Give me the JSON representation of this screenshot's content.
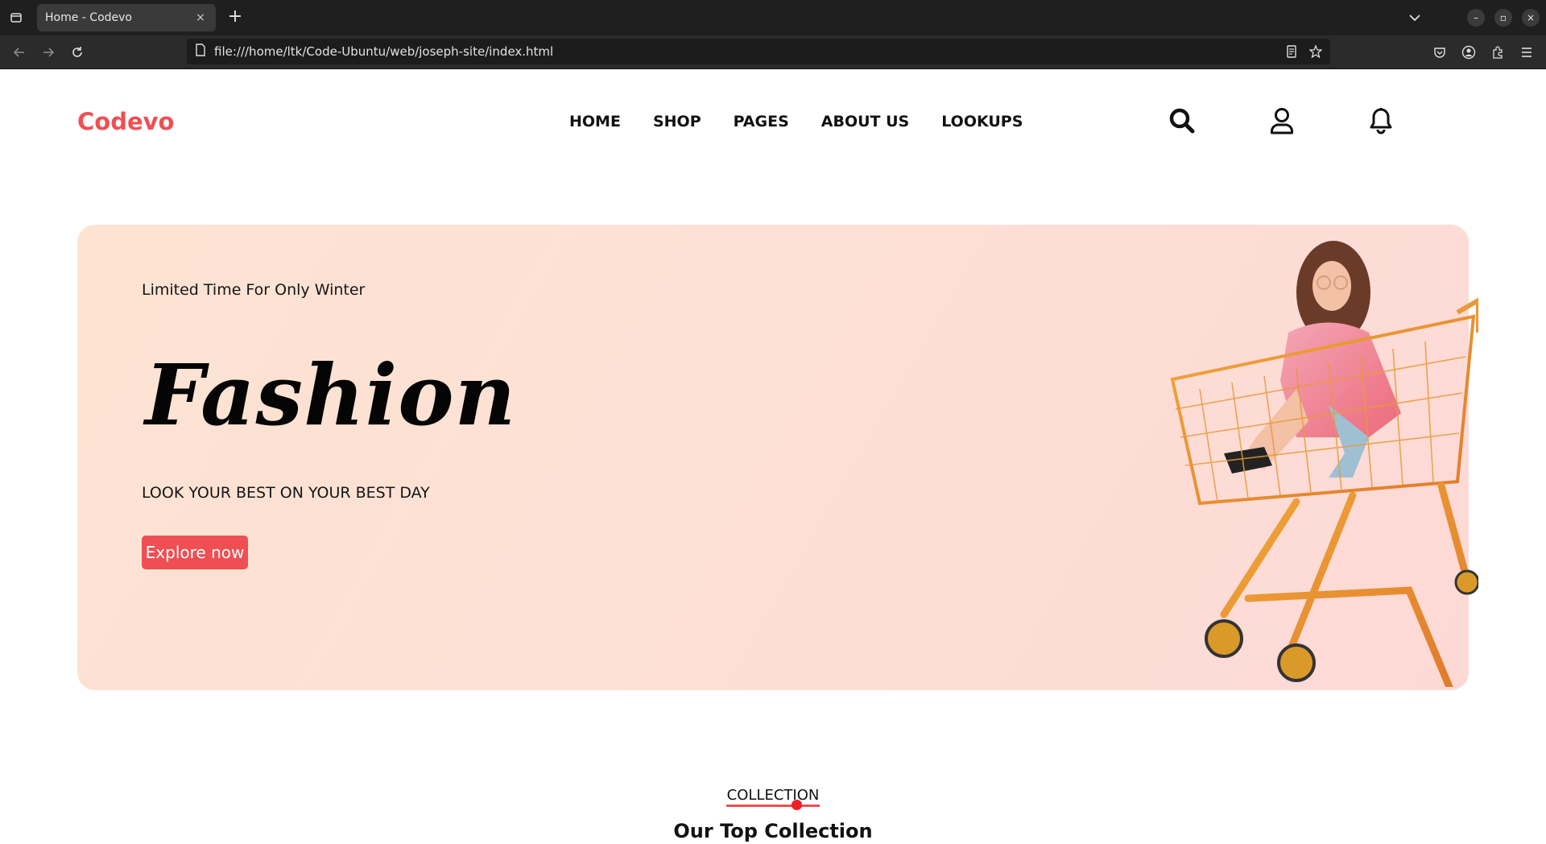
{
  "browser": {
    "tab_title": "Home - Codevo",
    "tab_close": "×",
    "new_tab": "+",
    "url": "file:///home/ltk/Code-Ubuntu/web/joseph-site/index.html",
    "window_buttons": [
      "–",
      "▫",
      "×"
    ]
  },
  "header": {
    "logo": "Codevo",
    "menu": [
      "HOME",
      "SHOP",
      "PAGES",
      "ABOUT US",
      "LOOKUPS"
    ],
    "icons": [
      "search-icon",
      "user-icon",
      "bell-icon"
    ]
  },
  "hero": {
    "tagline": "Limited Time For Only Winter",
    "title": "Fashion",
    "subtitle": "LOOK YOUR BEST ON YOUR BEST DAY",
    "cta": "Explore now"
  },
  "collection": {
    "kicker": "COLLECTION",
    "title": "Our Top Collection"
  },
  "colors": {
    "brand": "#ef4f53",
    "hero_bg": "#fde0d6"
  }
}
